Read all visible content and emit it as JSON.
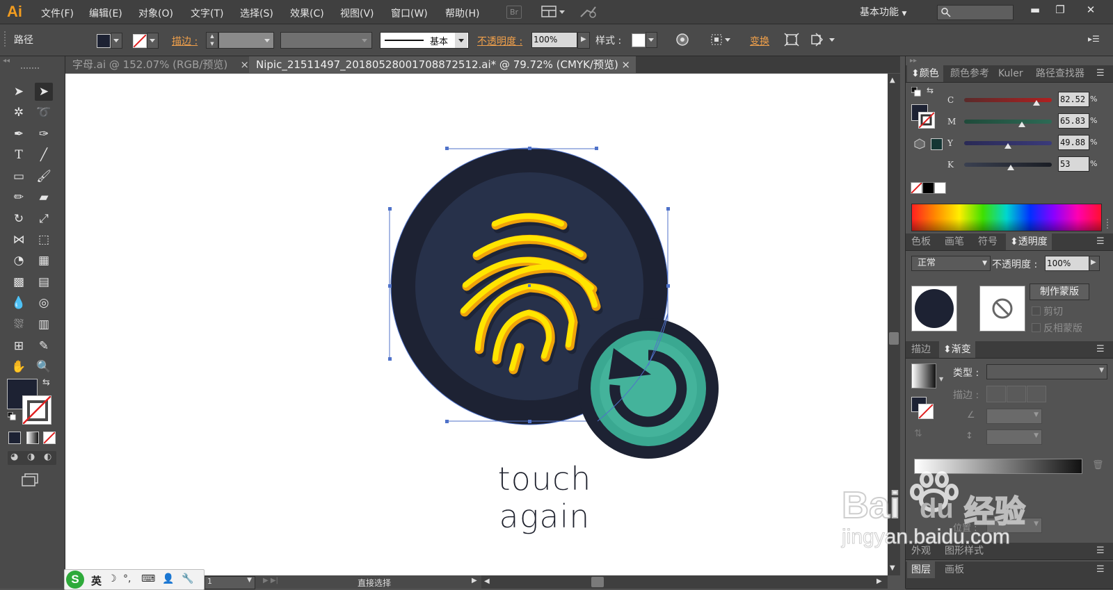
{
  "app": {
    "logo": "Ai",
    "workspace": "基本功能",
    "br_badge": "Br"
  },
  "menu": [
    "文件(F)",
    "编辑(E)",
    "对象(O)",
    "文字(T)",
    "选择(S)",
    "效果(C)",
    "视图(V)",
    "窗口(W)",
    "帮助(H)"
  ],
  "window_buttons": {
    "minimize": "▬",
    "restore": "❐",
    "close": "✕"
  },
  "control_bar": {
    "object_type": "路径",
    "stroke_label": "描边 :",
    "stroke_profile": "基本",
    "opacity_label": "不透明度 :",
    "opacity_value": "100%",
    "style_label": "样式 :",
    "transform_label": "变换"
  },
  "tabs": [
    {
      "label": "字母.ai @ 152.07% (RGB/预览)",
      "close": "×",
      "active": false
    },
    {
      "label": "Nipic_21511497_20180528001708872512.ai* @ 79.72% (CMYK/预览)",
      "close": "×",
      "active": true
    }
  ],
  "artwork": {
    "caption": "touch again",
    "colors": {
      "outer_ring": "#1d2233",
      "inner_circle": "#27314a",
      "fingerprint_yellow": "#ffe500",
      "fingerprint_orange": "#f0a30a",
      "badge_ring": "#1d2233",
      "badge_teal": "#3aa891",
      "badge_inner": "#44b39b"
    }
  },
  "status_bar": {
    "page": "1",
    "tool": "直接选择"
  },
  "color_panel": {
    "tabs": [
      "颜色",
      "颜色参考",
      "Kuler",
      "路径查找器"
    ],
    "channels": [
      {
        "label": "C",
        "value": "82.52",
        "fraction": 0.825,
        "unit": "%"
      },
      {
        "label": "M",
        "value": "65.83",
        "fraction": 0.658,
        "unit": "%"
      },
      {
        "label": "Y",
        "value": "49.88",
        "fraction": 0.499,
        "unit": "%"
      },
      {
        "label": "K",
        "value": "53",
        "fraction": 0.53,
        "unit": "%"
      }
    ],
    "fill_color": "#1d2233",
    "out_of_gamut_color": "#153634"
  },
  "transparency_panel": {
    "tabs": [
      "色板",
      "画笔",
      "符号",
      "透明度"
    ],
    "blend_mode": "正常",
    "opacity_label": "不透明度 :",
    "opacity_value": "100%",
    "make_mask": "制作蒙版",
    "clip": "剪切",
    "invert_mask": "反相蒙版"
  },
  "gradient_panel": {
    "tabs": [
      "描边",
      "渐变"
    ],
    "type_label": "类型 :",
    "stroke_label": "描边 :",
    "position_label": "位置 :"
  },
  "bottom_panels": {
    "row1": [
      "外观",
      "图形样式"
    ],
    "row2": [
      "图层",
      "画板"
    ]
  },
  "ime": {
    "mode": "英"
  },
  "watermark": {
    "brand": "Bai",
    "brand_du": "du",
    "jingyan": "经验",
    "url": "jingyan.baidu.com"
  }
}
